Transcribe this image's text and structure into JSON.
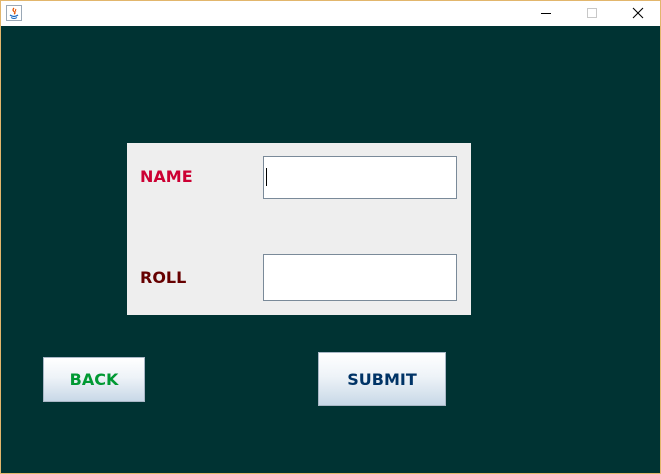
{
  "window": {
    "min_label": "Minimize",
    "max_label": "Maximize",
    "close_label": "Close"
  },
  "form": {
    "name_label": "NAME",
    "name_value": "",
    "roll_label": "ROLL",
    "roll_value": ""
  },
  "buttons": {
    "back_label": "BACK",
    "submit_label": "SUBMIT"
  },
  "colors": {
    "background": "#003333",
    "panel": "#eeeeee",
    "name_label": "#cc0033",
    "roll_label": "#660000",
    "back_text": "#009933",
    "submit_text": "#003366"
  },
  "icons": {
    "app": "java-icon",
    "minimize": "minimize-icon",
    "maximize": "maximize-icon",
    "close": "close-icon"
  }
}
